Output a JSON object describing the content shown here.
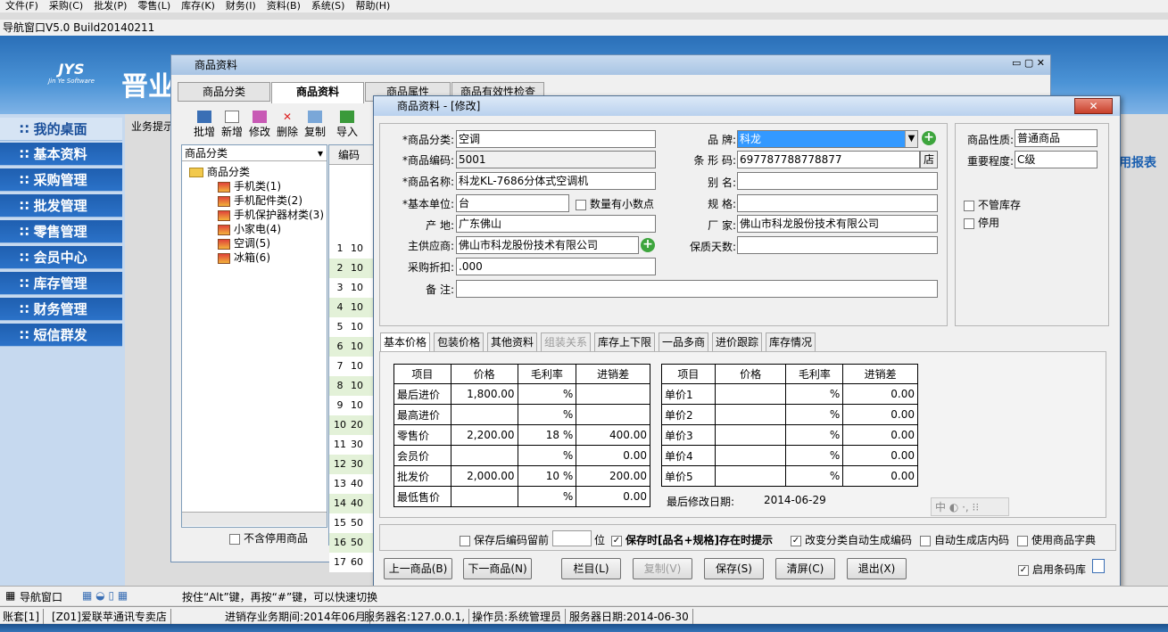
{
  "menu": [
    "文件(F)",
    "采购(C)",
    "批发(P)",
    "零售(L)",
    "库存(K)",
    "财务(I)",
    "资料(B)",
    "系统(S)",
    "帮助(H)"
  ],
  "app_title": "导航窗口V5.0 Build20140211",
  "brand": {
    "logo": "JYS",
    "logo_sub": "Jin Ye Software",
    "text": "晋业"
  },
  "nav": [
    "∷ 我的桌面",
    "∷ 基本资料",
    "∷ 采购管理",
    "∷ 批发管理",
    "∷ 零售管理",
    "∷ 会员中心",
    "∷ 库存管理",
    "∷ 财务管理",
    "∷ 短信群发"
  ],
  "business_hint": "业务提示",
  "right_report": "用报表",
  "product_window": {
    "title": "商品资料",
    "tabs": [
      "商品分类",
      "商品资料",
      "商品属性",
      "商品有效性检查"
    ],
    "toolbar": [
      "批增",
      "新增",
      "修改",
      "删除",
      "复制",
      "导入"
    ],
    "category_combo": "商品分类",
    "tree": {
      "root": "商品分类",
      "items": [
        "手机类(1)",
        "手机配件类(2)",
        "手机保护器材类(3)",
        "小家电(4)",
        "空调(5)",
        "冰箱(6)"
      ]
    },
    "exclude_disabled": "不含停用商品",
    "grid_header": "编码",
    "rows": [
      [
        "1",
        "10"
      ],
      [
        "2",
        "10"
      ],
      [
        "3",
        "10"
      ],
      [
        "4",
        "10"
      ],
      [
        "5",
        "10"
      ],
      [
        "6",
        "10"
      ],
      [
        "7",
        "10"
      ],
      [
        "8",
        "10"
      ],
      [
        "9",
        "10"
      ],
      [
        "10",
        "20"
      ],
      [
        "11",
        "30"
      ],
      [
        "12",
        "30"
      ],
      [
        "13",
        "40"
      ],
      [
        "14",
        "40"
      ],
      [
        "15",
        "50"
      ],
      [
        "16",
        "50"
      ],
      [
        "17",
        "60"
      ]
    ]
  },
  "dialog": {
    "title": "商品资料 - [修改]",
    "labels": {
      "category": "*商品分类:",
      "code": "*商品编码:",
      "name": "*商品名称:",
      "unit": "*基本单位:",
      "origin": "产    地:",
      "supplier": "主供应商:",
      "discount": "采购折扣:",
      "remark": "备    注:",
      "brand": "品    牌:",
      "barcode": "条 形 码:",
      "alias": "别    名:",
      "spec": "规    格:",
      "maker": "厂    家:",
      "shelf": "保质天数:",
      "nature": "商品性质:",
      "importance": "重要程度:"
    },
    "values": {
      "category": "空调",
      "code": "5001",
      "name": "科龙KL-7686分体式空调机",
      "unit": "台",
      "origin": "广东佛山",
      "supplier": "佛山市科龙股份技术有限公司",
      "discount": ".000",
      "remark": "",
      "brand": "科龙",
      "barcode": "697787788778877",
      "alias": "",
      "spec": "",
      "maker": "佛山市科龙股份技术有限公司",
      "shelf": "",
      "nature": "普通商品",
      "importance": "C级"
    },
    "decimal_check": "数量有小数点",
    "shop_btn": "店",
    "no_stock": "不管库存",
    "disabled": "停用",
    "subtabs": [
      "基本价格",
      "包装价格",
      "其他资料",
      "组装关系",
      "库存上下限",
      "一品多商",
      "进价跟踪",
      "库存情况"
    ],
    "price_table": {
      "headers": [
        "项目",
        "价格",
        "毛利率",
        "进销差"
      ],
      "rows": [
        [
          "最后进价",
          "1,800.00",
          "%",
          ""
        ],
        [
          "最高进价",
          "",
          "%",
          ""
        ],
        [
          "零售价",
          "2,200.00",
          "18 %",
          "400.00"
        ],
        [
          "会员价",
          "",
          "%",
          "0.00"
        ],
        [
          "批发价",
          "2,000.00",
          "10 %",
          "200.00"
        ],
        [
          "最低售价",
          "",
          "%",
          "0.00"
        ]
      ]
    },
    "unit_table": {
      "headers": [
        "项目",
        "价格",
        "毛利率",
        "进销差"
      ],
      "rows": [
        [
          "单价1",
          "",
          "%",
          "0.00"
        ],
        [
          "单价2",
          "",
          "%",
          "0.00"
        ],
        [
          "单价3",
          "",
          "%",
          "0.00"
        ],
        [
          "单价4",
          "",
          "%",
          "0.00"
        ],
        [
          "单价5",
          "",
          "%",
          "0.00"
        ]
      ]
    },
    "last_modified_label": "最后修改日期:",
    "last_modified": "2014-06-29",
    "options": {
      "keep_code": "保存后编码留前",
      "keep_unit": "位",
      "warn_exists": "保存时[品名+规格]存在时提示",
      "auto_code": "改变分类自动生成编码",
      "auto_shop_code": "自动生成店内码",
      "use_dict": "使用商品字典",
      "use_barcode": "启用条码库"
    },
    "buttons": [
      "上一商品(B)",
      "下一商品(N)",
      "栏目(L)",
      "复制(V)",
      "保存(S)",
      "清屏(C)",
      "退出(X)"
    ]
  },
  "bottom": {
    "nav_label": "导航窗口",
    "hint": "按住“Alt”键，再按“#”键，可以快速切换"
  },
  "status": [
    "账套[1]",
    "[Z01]爱联苹通讯专卖店",
    "进销存业务期间:2014年06月",
    "服务器名:127.0.0.1,",
    "操作员:系统管理员",
    "服务器日期:2014-06-30"
  ]
}
